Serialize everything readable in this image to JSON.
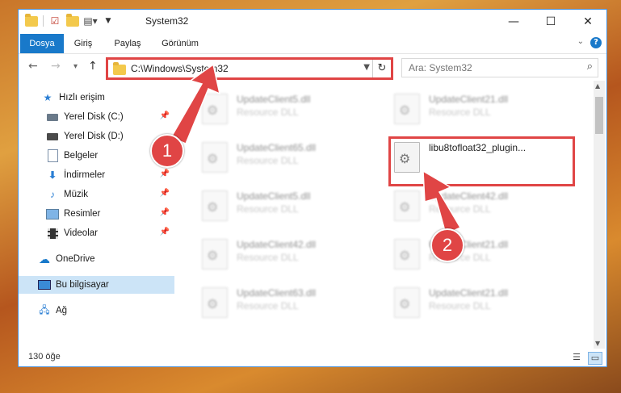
{
  "window": {
    "title": "System32",
    "controls": {
      "minimize": "—",
      "maximize": "☐",
      "close": "✕"
    }
  },
  "ribbon": {
    "tabs": [
      "Dosya",
      "Giriş",
      "Paylaş",
      "Görünüm"
    ],
    "help": "?"
  },
  "nav": {
    "back": "←",
    "forward": "→",
    "recent": "▾",
    "up": "↑",
    "address": "C:\\Windows\\System32",
    "search_placeholder": "Ara: System32"
  },
  "sidebar": {
    "items": [
      {
        "label": "Hızlı erişim",
        "icon": "star-icon",
        "pinned": false,
        "selected": false
      },
      {
        "label": "Yerel Disk (C:)",
        "icon": "drive-icon",
        "pinned": true,
        "selected": false
      },
      {
        "label": "Yerel Disk (D:)",
        "icon": "drive-icon",
        "pinned": false,
        "selected": false
      },
      {
        "label": "Belgeler",
        "icon": "document-icon",
        "pinned": true,
        "selected": false
      },
      {
        "label": "İndirmeler",
        "icon": "download-icon",
        "pinned": true,
        "selected": false
      },
      {
        "label": "Müzik",
        "icon": "music-icon",
        "pinned": true,
        "selected": false
      },
      {
        "label": "Resimler",
        "icon": "picture-icon",
        "pinned": true,
        "selected": false
      },
      {
        "label": "Videolar",
        "icon": "video-icon",
        "pinned": true,
        "selected": false
      },
      {
        "label": "OneDrive",
        "icon": "cloud-icon",
        "pinned": false,
        "selected": false
      },
      {
        "label": "Bu bilgisayar",
        "icon": "computer-icon",
        "pinned": false,
        "selected": true
      },
      {
        "label": "Ağ",
        "icon": "network-icon",
        "pinned": false,
        "selected": false
      }
    ]
  },
  "files": [
    {
      "name": "UpdateClient5.dll",
      "desc": "Resource DLL"
    },
    {
      "name": "UpdateClient21.dll",
      "desc": "Resource DLL"
    },
    {
      "name": "UpdateClient65.dll",
      "desc": "Resource DLL"
    },
    {
      "name": "libu8tofloat32_plugin...",
      "desc": ""
    },
    {
      "name": "UpdateClient5.dll",
      "desc": "Resource DLL"
    },
    {
      "name": "UpdateClient42.dll",
      "desc": "Resource DLL"
    },
    {
      "name": "UpdateClient42.dll",
      "desc": "Resource DLL"
    },
    {
      "name": "UpdateClient21.dll",
      "desc": "Resource DLL"
    },
    {
      "name": "UpdateClient63.dll",
      "desc": "Resource DLL"
    },
    {
      "name": "UpdateClient21.dll",
      "desc": "Resource DLL"
    }
  ],
  "status": {
    "count": "130 öğe"
  },
  "callouts": [
    "1",
    "2"
  ],
  "colors": {
    "accent": "#1979ca",
    "highlight": "#e04545",
    "selection": "#cce4f7"
  }
}
